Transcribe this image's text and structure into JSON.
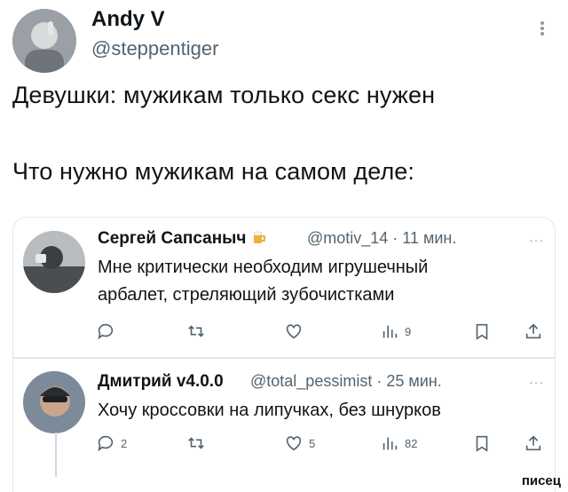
{
  "author": {
    "name": "Andy V",
    "handle": "@steppentiger"
  },
  "tweet": {
    "line1": "Девушки: мужикам только секс нужен",
    "line2": "Что нужно мужикам на самом деле:"
  },
  "replies": [
    {
      "name": "Сергей Сапсаныч",
      "meta": "@motiv_14 · 11 мин.",
      "text_lines": [
        "Мне критически необходим игрушечный",
        "арбалет, стреляющий зубочистками"
      ],
      "reply_count": "",
      "like_count": "",
      "view_count": "9"
    },
    {
      "name": "Дмитрий v4.0.0",
      "meta": "@total_pessimist · 25 мин.",
      "text_lines": [
        "Хочу кроссовки на липучках, без шнурков"
      ],
      "reply_count": "2",
      "like_count": "5",
      "view_count": "82"
    }
  ],
  "watermark": "писец",
  "icons": [
    "more-icon",
    "reply-icon",
    "retweet-icon",
    "like-icon",
    "views-icon",
    "bookmark-icon",
    "share-icon",
    "beer-emoji-icon"
  ]
}
